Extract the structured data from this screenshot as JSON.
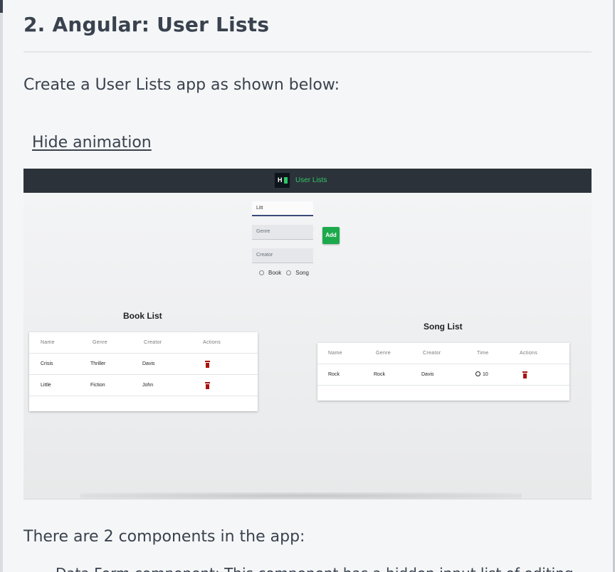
{
  "heading": "2. Angular: User Lists",
  "intro": "Create a User Lists app as shown below:",
  "hide_link": "Hide animation",
  "outro": "There are 2 components in the app:",
  "cut_line": "Data Form component: This component has a hidden input list of editing",
  "demo": {
    "logo": "H",
    "app_title": "User Lists",
    "form": {
      "title_value": "Litt",
      "genre_placeholder": "Genre",
      "creator_placeholder": "Creator",
      "add_label": "Add",
      "radio_book": "Book",
      "radio_song": "Song"
    },
    "book_list": {
      "title": "Book List",
      "columns": [
        "Name",
        "Genre",
        "Creator",
        "Actions"
      ],
      "rows": [
        {
          "name": "Crisis",
          "genre": "Thriller",
          "creator": "Davis"
        },
        {
          "name": "Little",
          "genre": "Fiction",
          "creator": "John"
        }
      ]
    },
    "song_list": {
      "title": "Song List",
      "columns": [
        "Name",
        "Genre",
        "Creator",
        "Time",
        "Actions"
      ],
      "rows": [
        {
          "name": "Rock",
          "genre": "Rock",
          "creator": "Davis",
          "time": "10"
        }
      ]
    }
  },
  "colors": {
    "text": "#39424e",
    "app_bar": "#2c323a",
    "brand_green": "#2ec866",
    "add_button": "#1ba94c",
    "trash": "#a8140e"
  }
}
